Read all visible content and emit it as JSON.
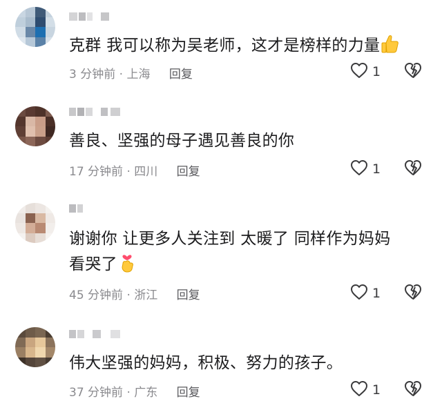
{
  "comments": [
    {
      "text": "克群 我可以称为吴老师，这才是榜样的力量",
      "emoji": "thumbs-up-emoji",
      "time": "3 分钟前",
      "location": "· 上海",
      "reply_label": "回复",
      "likes": "1"
    },
    {
      "text": "善良、坚强的母子遇见善良的你",
      "time": "17 分钟前",
      "location": "· 四川",
      "reply_label": "回复",
      "likes": "1"
    },
    {
      "text": "谢谢你 让更多人关注到 太暖了 同样作为妈妈 看哭了",
      "emoji": "finger-heart-emoji",
      "time": "45 分钟前",
      "location": "· 浙江",
      "reply_label": "回复",
      "likes": "1"
    },
    {
      "text": "伟大坚强的妈妈，积极、努力的孩子。",
      "time": "37 分钟前",
      "location": "· 广东",
      "reply_label": "回复",
      "likes": "1"
    }
  ],
  "colors": {
    "text": "#1c1c1e",
    "meta": "#8a8a8e",
    "icon": "#3a3a3c"
  }
}
